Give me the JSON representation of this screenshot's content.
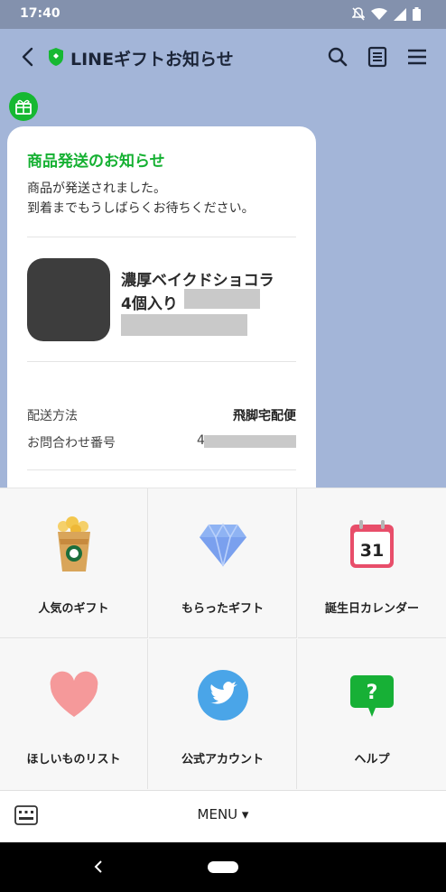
{
  "status_bar": {
    "time": "17:40",
    "icons": [
      "bell-off-icon",
      "wifi-icon",
      "signal-icon",
      "battery-icon"
    ]
  },
  "header": {
    "title": "LINEギフトお知らせ",
    "icons": [
      "back-arrow-icon",
      "shield-icon",
      "search-icon",
      "note-icon",
      "hamburger-menu-icon"
    ]
  },
  "message": {
    "title": "商品発送のお知らせ",
    "body_lines": [
      "商品が発送されました。",
      "到着までもうしばらくお待ちください。"
    ],
    "product": {
      "name_line1": "濃厚ベイクドショコラ",
      "name_line2": "4個入り"
    },
    "details": [
      {
        "label": "配送方法",
        "value": "飛脚宅配便"
      },
      {
        "label": "お問合わせ番号",
        "value": "4"
      }
    ]
  },
  "menu_items": [
    {
      "label": "人気のギフト",
      "icon": "frappuccino-icon"
    },
    {
      "label": "もらったギフト",
      "icon": "diamond-icon"
    },
    {
      "label": "誕生日カレンダー",
      "icon": "calendar-icon",
      "icon_text": "31"
    },
    {
      "label": "ほしいものリスト",
      "icon": "heart-icon"
    },
    {
      "label": "公式アカウント",
      "icon": "twitter-bird-icon"
    },
    {
      "label": "ヘルプ",
      "icon": "help-bubble-icon",
      "icon_text": "?"
    }
  ],
  "bottom_bar": {
    "menu_label": "MENU ▾"
  },
  "colors": {
    "accent_green": "#14b031",
    "chat_bg": "#a3b5d8",
    "twitter_blue": "#4aa5e8",
    "heart_pink": "#f5999a",
    "calendar_red": "#e84e6a"
  }
}
